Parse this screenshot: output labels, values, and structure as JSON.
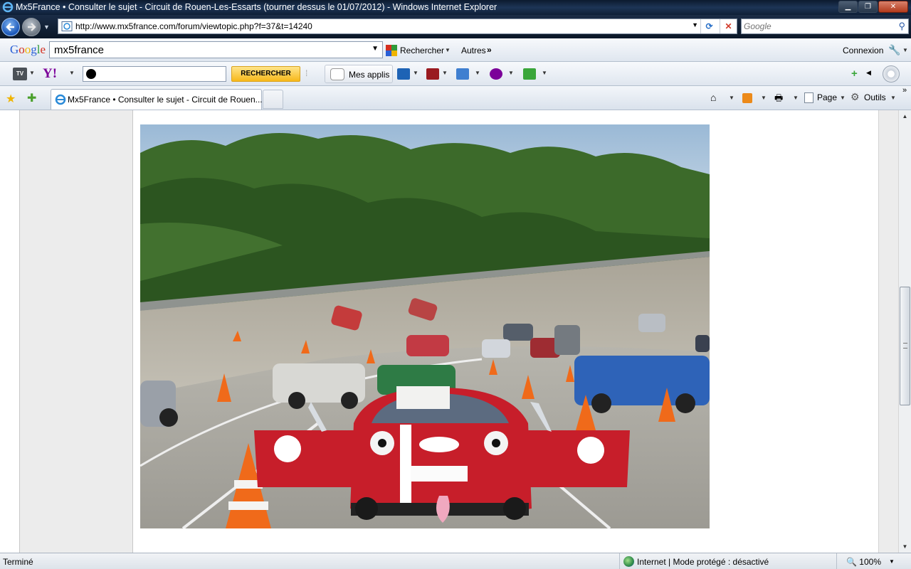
{
  "window": {
    "title": "Mx5France • Consulter le sujet - Circuit de Rouen-Les-Essarts (tourner dessus le 01/07/2012) - Windows Internet Explorer"
  },
  "address": {
    "url": "http://www.mx5france.com/forum/viewtopic.php?f=37&t=14240",
    "search_placeholder": "Google"
  },
  "google_toolbar": {
    "logo": "Google",
    "query": "mx5france",
    "search_label": "Rechercher",
    "more_label": "Autres",
    "signin_label": "Connexion"
  },
  "yahoo_toolbar": {
    "tv_label": "TV",
    "logo": "Y!",
    "search_button": "RECHERCHER",
    "apps_label": "Mes applis"
  },
  "tabs_bar": {
    "active_tab_label": "Mx5France • Consulter le sujet - Circuit de Rouen...",
    "page_menu": "Page",
    "tools_menu": "Outils"
  },
  "content": {
    "photo_alt": "Mazda MX-5 numéro 13 sur l'anneau de vitesse"
  },
  "status": {
    "text": "Terminé",
    "zone": "Internet | Mode protégé : désactivé",
    "zoom": "100%"
  },
  "colors": {
    "titlebar": "#1d3556",
    "accent": "#2a70c8",
    "search_button": "#f7b81a"
  }
}
